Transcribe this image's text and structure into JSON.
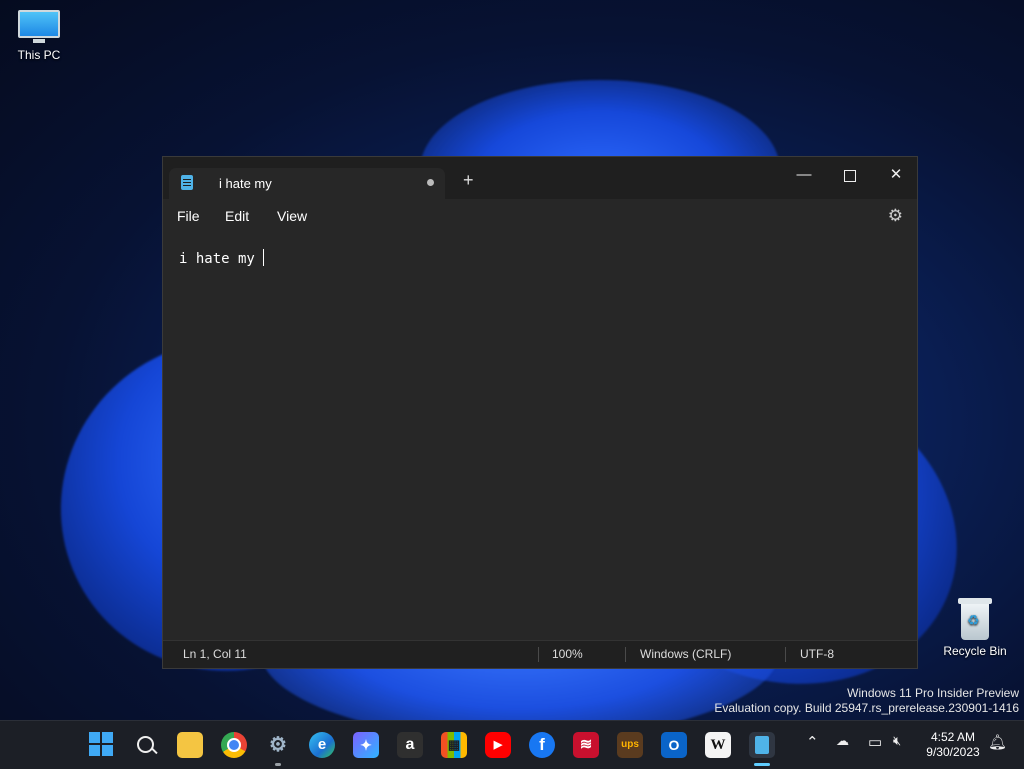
{
  "desktop": {
    "icons": [
      {
        "label": "This PC"
      },
      {
        "label": "Recycle Bin"
      }
    ],
    "watermark": {
      "line1": "Windows 11 Pro Insider Preview",
      "line2": "Evaluation copy. Build 25947.rs_prerelease.230901-1416"
    }
  },
  "notepad": {
    "tab_title": "i hate my",
    "menu": {
      "file": "File",
      "edit": "Edit",
      "view": "View"
    },
    "content": "i hate my",
    "status": {
      "position": "Ln 1, Col 11",
      "zoom": "100%",
      "line_endings": "Windows (CRLF)",
      "encoding": "UTF-8"
    }
  },
  "taskbar": {
    "apps": [
      {
        "name": "start-button",
        "glyph": "start"
      },
      {
        "name": "search-button",
        "glyph": "search"
      },
      {
        "name": "file-explorer",
        "glyph": ""
      },
      {
        "name": "chrome",
        "glyph": ""
      },
      {
        "name": "settings",
        "glyph": "⚙"
      },
      {
        "name": "edge",
        "glyph": "e"
      },
      {
        "name": "copilot",
        "glyph": "✦"
      },
      {
        "name": "amazon",
        "glyph": "a"
      },
      {
        "name": "microsoft-store",
        "glyph": "▦"
      },
      {
        "name": "youtube",
        "glyph": "▶"
      },
      {
        "name": "facebook",
        "glyph": "f"
      },
      {
        "name": "bank-of-america",
        "glyph": "≋"
      },
      {
        "name": "ups",
        "glyph": "ups"
      },
      {
        "name": "outlook",
        "glyph": "O"
      },
      {
        "name": "wikipedia",
        "glyph": "W"
      },
      {
        "name": "notepad",
        "glyph": ""
      }
    ],
    "clock": {
      "time": "4:52 AM",
      "date": "9/30/2023"
    }
  },
  "colors": {
    "accent": "#60cdff",
    "window_bg": "#272727",
    "titlebar_bg": "#1f1f1f",
    "taskbar_bg": "#1c1f26"
  }
}
